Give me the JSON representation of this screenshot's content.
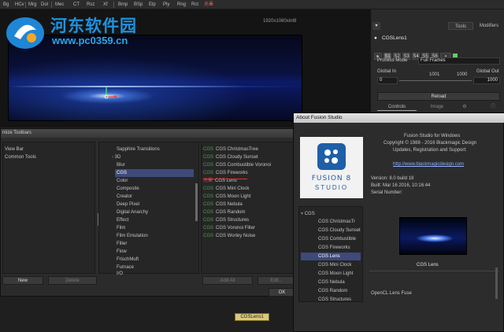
{
  "toolbar": {
    "items": [
      "Bg",
      "HCv",
      "Mrg",
      "Dol",
      "Mec",
      "CT",
      "Rsz",
      "Xf",
      "Bmp",
      "BSp",
      "Elp",
      "Ply",
      "Rng",
      "Rct",
      "光晕"
    ]
  },
  "viewer": {
    "resolution": "1920x1080xint8"
  },
  "watermark": {
    "title": "河东软件园",
    "url": "www.pc0359.cn"
  },
  "inspector": {
    "tabs": [
      "Tools",
      "Modifiers"
    ],
    "node_name": "CGSLens1",
    "chips": [
      "S1",
      "S2",
      "S3",
      "S4",
      "S5",
      "S6"
    ],
    "process_mode_label": "Process Mode",
    "process_mode_value": "Full Frames",
    "global_in_label": "Global In",
    "global_out_label": "Global Out",
    "global_in_value": "0",
    "mid_values": [
      "1001",
      "1000"
    ],
    "global_out_value": "1000",
    "reload_label": "Reload",
    "controls_tab": "Controls",
    "image_tab": "Image"
  },
  "customize": {
    "title": "mize Toolbars",
    "left_items": [
      "View Bar",
      "Common Tools"
    ],
    "middle_header": "Sapphire Transitions",
    "middle_items": [
      "3D",
      "Blur",
      "CGS",
      "Color",
      "Composite",
      "Creator",
      "Deep Pixel",
      "Digital Anarchy",
      "Effect",
      "Film",
      "Film Emulation",
      "Filter",
      "Flow",
      "FrischMuft",
      "Furnace",
      "I/O"
    ],
    "right_prefix": "CGS",
    "right_items": [
      "CGS ChristmasTree",
      "CGS Cloudy Sunset",
      "CGS Combustible Voronoi",
      "CGS Fireworks",
      "CGS Lens",
      "CGS Mini Clock",
      "CGS Moon Light",
      "CGS Nebula",
      "CGS Random",
      "CGS Structures",
      "CGS Voronoi Filter",
      "CGS Worley Noise"
    ],
    "lens_tag": "光晕",
    "buttons": {
      "new": "New",
      "delete": "Delete",
      "add_all": "Add All",
      "edit": "Edit...",
      "ok": "OK"
    }
  },
  "about": {
    "title": "About Fusion Studio",
    "logo_line1": "FUSION 8",
    "logo_line2": "STUDIO",
    "product": "Fusion Studio for Windows",
    "copyright": "Copyright © 1988 - 2016 Blackmagic Design",
    "updates": "Updates, Registration and Support:",
    "link": "http://www.blackmagicdesign.com",
    "version": "Version: 8.0 build 18",
    "built": "Built: Mar 16 2016, 10:16:44",
    "serial": "Serial Number:",
    "tree_root": "CGS",
    "tree_items": [
      "CGS ChristmasTr",
      "CGS Cloudy Sunset",
      "CGS Combustible",
      "CGS Fireworks",
      "CGS Lens",
      "CGS Mini Clock",
      "CGS Moon Light",
      "CGS Nebula",
      "CGS Random",
      "CGS Structures"
    ],
    "plugin_name": "CGS Lens",
    "plugin_desc": "OpenCL Lens Fuse"
  },
  "nodegraph": {
    "node_label": "CGSLens1"
  }
}
